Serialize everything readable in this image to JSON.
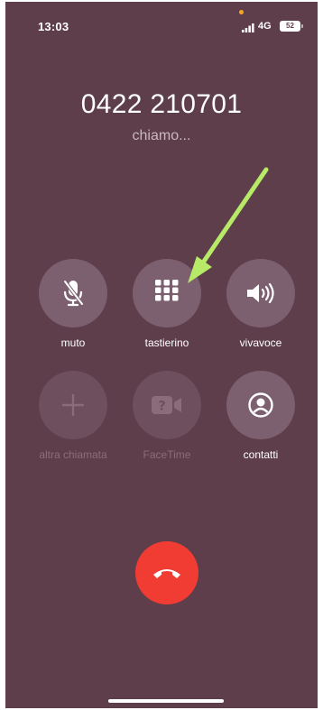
{
  "status_bar": {
    "time": "13:03",
    "network": "4G",
    "battery": "52",
    "privacy_dot_color": "#f5a623"
  },
  "call": {
    "number": "0422 210701",
    "status": "chiamo..."
  },
  "controls": [
    {
      "label": "muto",
      "icon": "mic-off-icon",
      "enabled": true
    },
    {
      "label": "tastierino",
      "icon": "keypad-icon",
      "enabled": true
    },
    {
      "label": "vivavoce",
      "icon": "speaker-icon",
      "enabled": true
    },
    {
      "label": "altra chiamata",
      "icon": "plus-icon",
      "enabled": false
    },
    {
      "label": "FaceTime",
      "icon": "facetime-icon",
      "enabled": false
    },
    {
      "label": "contatti",
      "icon": "contact-icon",
      "enabled": true
    }
  ],
  "end_call": {
    "icon": "end-call-icon",
    "color": "#f03c32"
  },
  "annotation": {
    "icon": "green-arrow-icon",
    "color": "#b7ea66",
    "points_to": "tastierino"
  },
  "theme": {
    "background": "#5e3e4b",
    "button": "#7d6070"
  }
}
